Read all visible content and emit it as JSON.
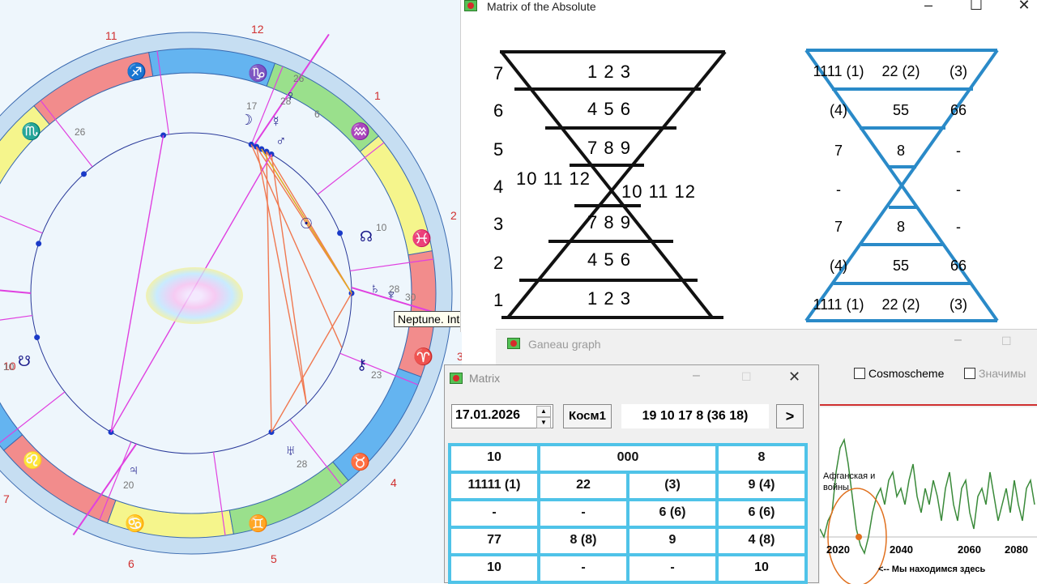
{
  "wheel": {
    "house_numbers": [
      "1",
      "2",
      "3",
      "4",
      "5",
      "6",
      "7",
      "10",
      "11",
      "12"
    ],
    "sign_icons": [
      "scorpio-icon",
      "sagittarius-icon",
      "capricorn-icon",
      "aquarius-icon",
      "pisces-icon",
      "aries-icon",
      "taurus-icon",
      "gemini-icon",
      "cancer-icon",
      "leo-icon"
    ],
    "degree_labels": [
      "26",
      "17",
      "26",
      "28",
      "6",
      "10",
      "28",
      "30",
      "23",
      "28",
      "20",
      "10"
    ],
    "tooltip": "Neptune. Integration, values, ideal",
    "colors": {
      "red": "#f28c8c",
      "yellow": "#f5f58c",
      "green": "#9ae08c",
      "blue": "#64b4f0",
      "magenta": "#e040e0",
      "orange": "#f07850"
    }
  },
  "moa": {
    "title": "Matrix of the Absolute",
    "controls": {
      "minimize": "–",
      "maximize": "☐",
      "close": "✕"
    },
    "levels": [
      "7",
      "6",
      "5",
      "4",
      "3",
      "2",
      "1"
    ],
    "hourglass_rows": [
      "1 2 3",
      "4 5 6",
      "7 8 9",
      "10 11 12",
      "10 11 12",
      "7 8 9",
      "4 5 6",
      "1 2 3"
    ],
    "blue_rows": [
      [
        "1111 (1)",
        "22 (2)",
        "(3)"
      ],
      [
        "(4)",
        "55",
        "66"
      ],
      [
        "7",
        "8",
        "-"
      ],
      [
        "-",
        "",
        "-"
      ],
      [
        "7",
        "8",
        "-"
      ],
      [
        "(4)",
        "55",
        "66"
      ],
      [
        "1111 (1)",
        "22 (2)",
        "(3)"
      ]
    ],
    "colors": {
      "hourglass": "#111111",
      "blue": "#2a8ac8"
    }
  },
  "ganeau": {
    "title": "Ganeau graph",
    "checkbox_cosmo": "Cosmoscheme",
    "checkbox_zn": "Значимы",
    "annotation": "Афганская и войны",
    "here_label": "<-- Мы находимся здесь",
    "x_ticks": [
      "2020",
      "2040",
      "2060",
      "2080"
    ],
    "colors": {
      "line": "#3a8a3a",
      "marker": "#e0701e",
      "axis": "#d03030"
    }
  },
  "matrix": {
    "title": "Matrix",
    "date": "17.01.2026",
    "kosm_button": "Косм1",
    "value": "19 10 17 8 (36 18)",
    "next_button": ">",
    "rows": [
      [
        "10",
        "000",
        "",
        "8"
      ],
      [
        "11111 (1)",
        "22",
        "(3)",
        "9 (4)"
      ],
      [
        "-",
        "-",
        "6 (6)",
        "6 (6)"
      ],
      [
        "77",
        "8 (8)",
        "9",
        "4 (8)"
      ],
      [
        "10",
        "-",
        "-",
        "10"
      ]
    ]
  }
}
